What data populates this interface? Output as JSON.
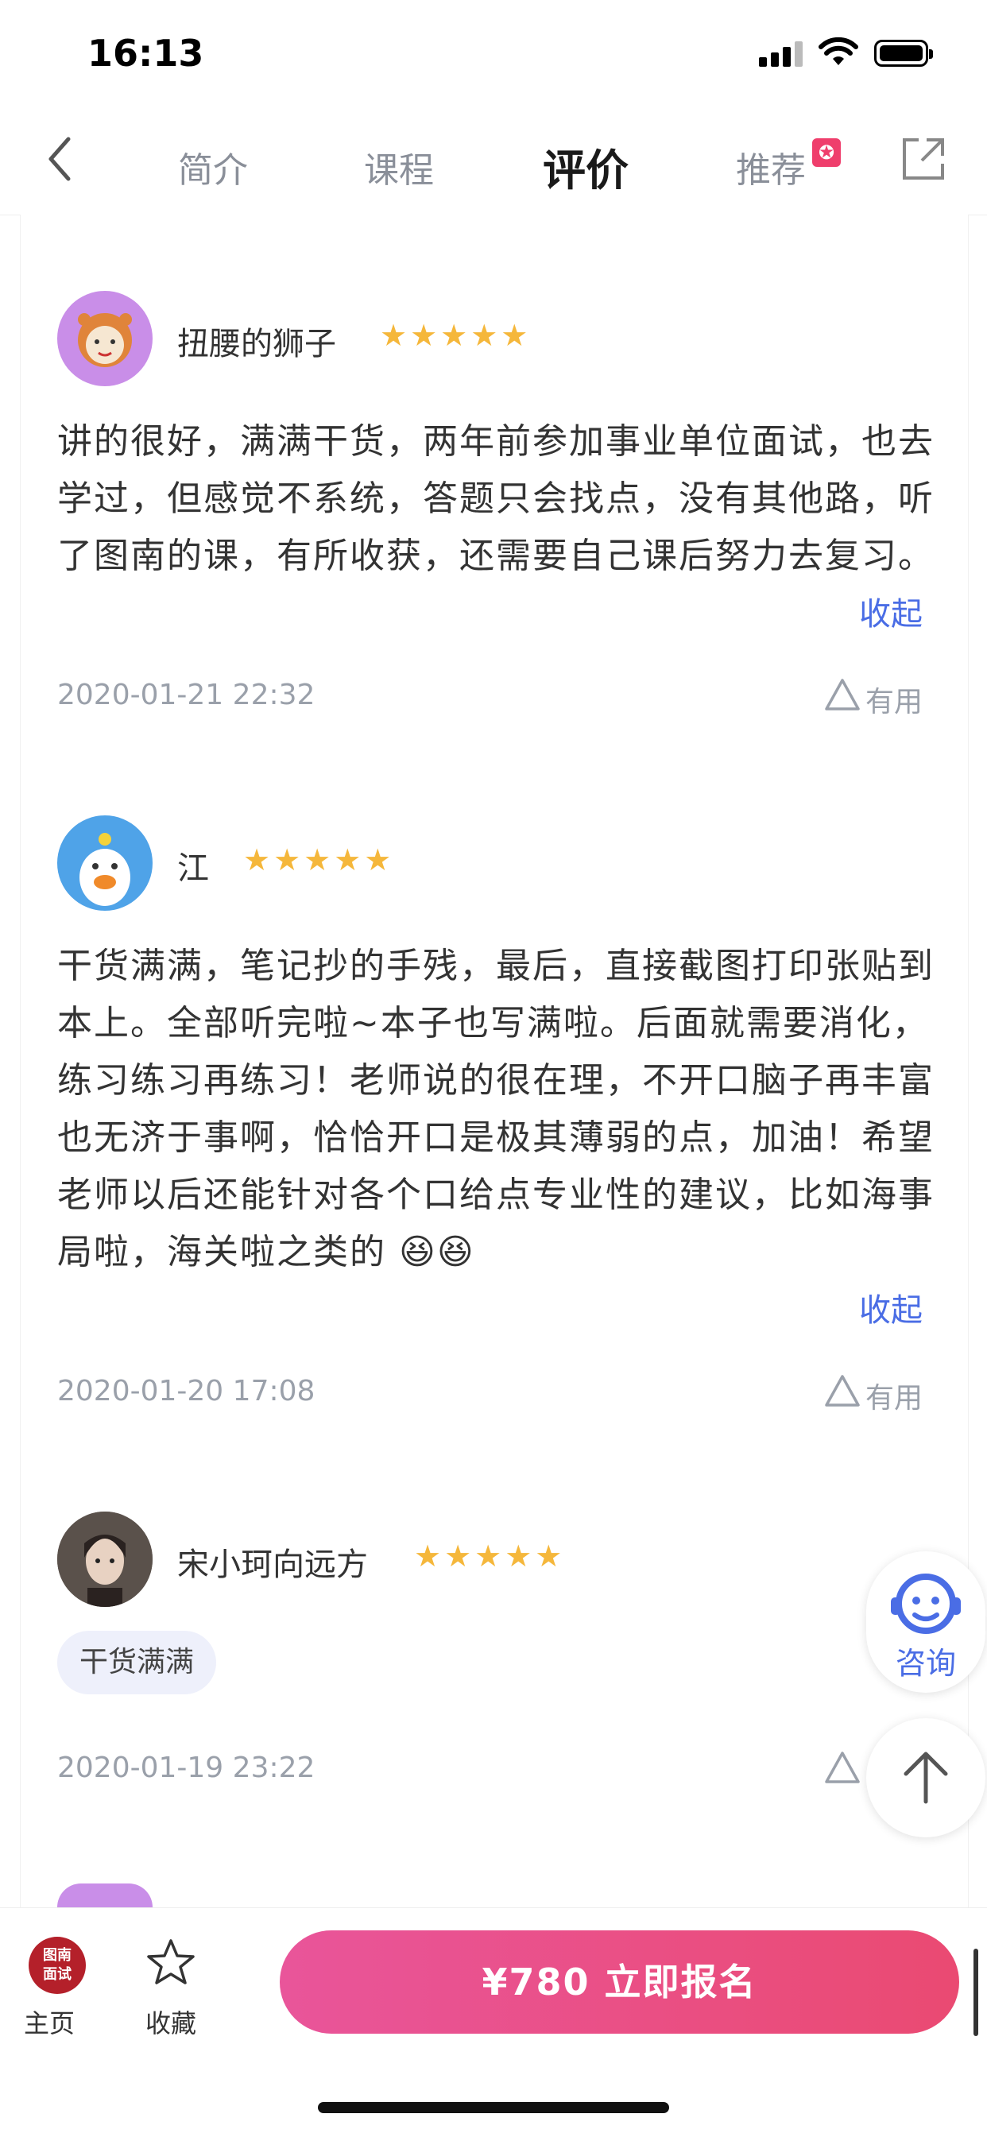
{
  "status_bar": {
    "time": "16:13"
  },
  "nav": {
    "tabs": [
      {
        "label": "简介",
        "active": false
      },
      {
        "label": "课程",
        "active": false
      },
      {
        "label": "评价",
        "active": true
      },
      {
        "label": "推荐",
        "active": false
      }
    ]
  },
  "reviews": [
    {
      "username": "扭腰的狮子",
      "rating": 5,
      "text": "讲的很好，满满干货，两年前参加事业单位面试，也去学过，但感觉不系统，答题只会找点，没有其他路，听了图南的课，有所收获，还需要自己课后努力去复习。",
      "collapse_label": "收起",
      "date": "2020-01-21 22:32",
      "useful_label": "有用"
    },
    {
      "username": "江",
      "rating": 5,
      "text": "干货满满，笔记抄的手残，最后，直接截图打印张贴到本上。全部听完啦~本子也写满啦。后面就需要消化，练习练习再练习！老师说的很在理，不开口脑子再丰富也无济于事啊，恰恰开口是极其薄弱的点，加油！希望老师以后还能针对各个口给点专业性的建议，比如海事局啦，海关啦之类的 😆😆",
      "collapse_label": "收起",
      "date": "2020-01-20 17:08",
      "useful_label": "有用"
    },
    {
      "username": "宋小珂向远方",
      "rating": 5,
      "tag": "干货满满",
      "date": "2020-01-19 23:22"
    }
  ],
  "stars_text": "★★★★★",
  "floating": {
    "consult_label": "咨询"
  },
  "bottom_bar": {
    "logo_line1": "图南",
    "logo_line2": "面试",
    "home_label": "主页",
    "favorite_label": "收藏",
    "enroll_label": "¥780 立即报名"
  },
  "colors": {
    "accent_blue": "#4a6de5",
    "star": "#f5b73b",
    "cta_start": "#e9559a",
    "cta_end": "#ea4a72"
  }
}
